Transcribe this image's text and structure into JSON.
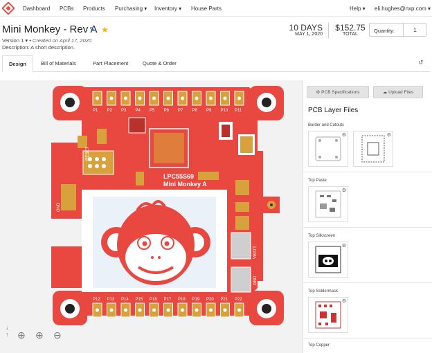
{
  "nav": {
    "items": [
      "Dashboard",
      "PCBs",
      "Products",
      "Purchasing ▾",
      "Inventory ▾",
      "House Parts"
    ],
    "help": "Help ▾",
    "user": "eli.hughes@nxp.com ▾"
  },
  "header": {
    "title": "Mini Monkey - Rev A",
    "version": "Version  1 ▾",
    "created": "Created on April 17, 2020",
    "description": "Description: A short description.",
    "lead_time": "10 DAYS",
    "ship_date": "MAY 1, 2020",
    "price": "$152.75",
    "price_label": "TOTAL",
    "qty_label": "Quantity:",
    "qty_value": "1"
  },
  "tabs": [
    "Design",
    "Bill of Materials",
    "Part Placement",
    "Quote & Order"
  ],
  "board": {
    "chip_line1": "LPC55S69",
    "chip_line2": "Mini Monkey A",
    "reset": "RESET",
    "gnd_left": "GND",
    "vbatt": "VBATT",
    "gnd_right": "GND",
    "top_pins": [
      "P1",
      "P2",
      "P3",
      "P4",
      "P5",
      "P6",
      "P7",
      "P8",
      "P9",
      "P10",
      "P11"
    ],
    "bottom_pins": [
      "P12",
      "P13",
      "P14",
      "P15",
      "P16",
      "P17",
      "P18",
      "P19",
      "P20",
      "P21",
      "P22"
    ],
    "colors": {
      "board": "#e8483f",
      "pad": "#d9a13b",
      "screen": "#eaf1f8"
    }
  },
  "sidebar": {
    "spec_button": "PCB Specifications",
    "upload_button": "Upload Files",
    "title": "PCB Layer Files",
    "sections": [
      "Border and Cutouts",
      "Top Paste",
      "Top Silkscreen",
      "Top Soldermask",
      "Top Copper"
    ]
  },
  "icons": {
    "edit": "pencil-icon",
    "star": "star-icon",
    "history": "history-icon",
    "gear": "gear-icon",
    "cloud": "cloud-upload-icon",
    "zoom_in": "zoom-in-icon",
    "zoom_out": "zoom-out-icon",
    "center": "crosshair-icon"
  }
}
